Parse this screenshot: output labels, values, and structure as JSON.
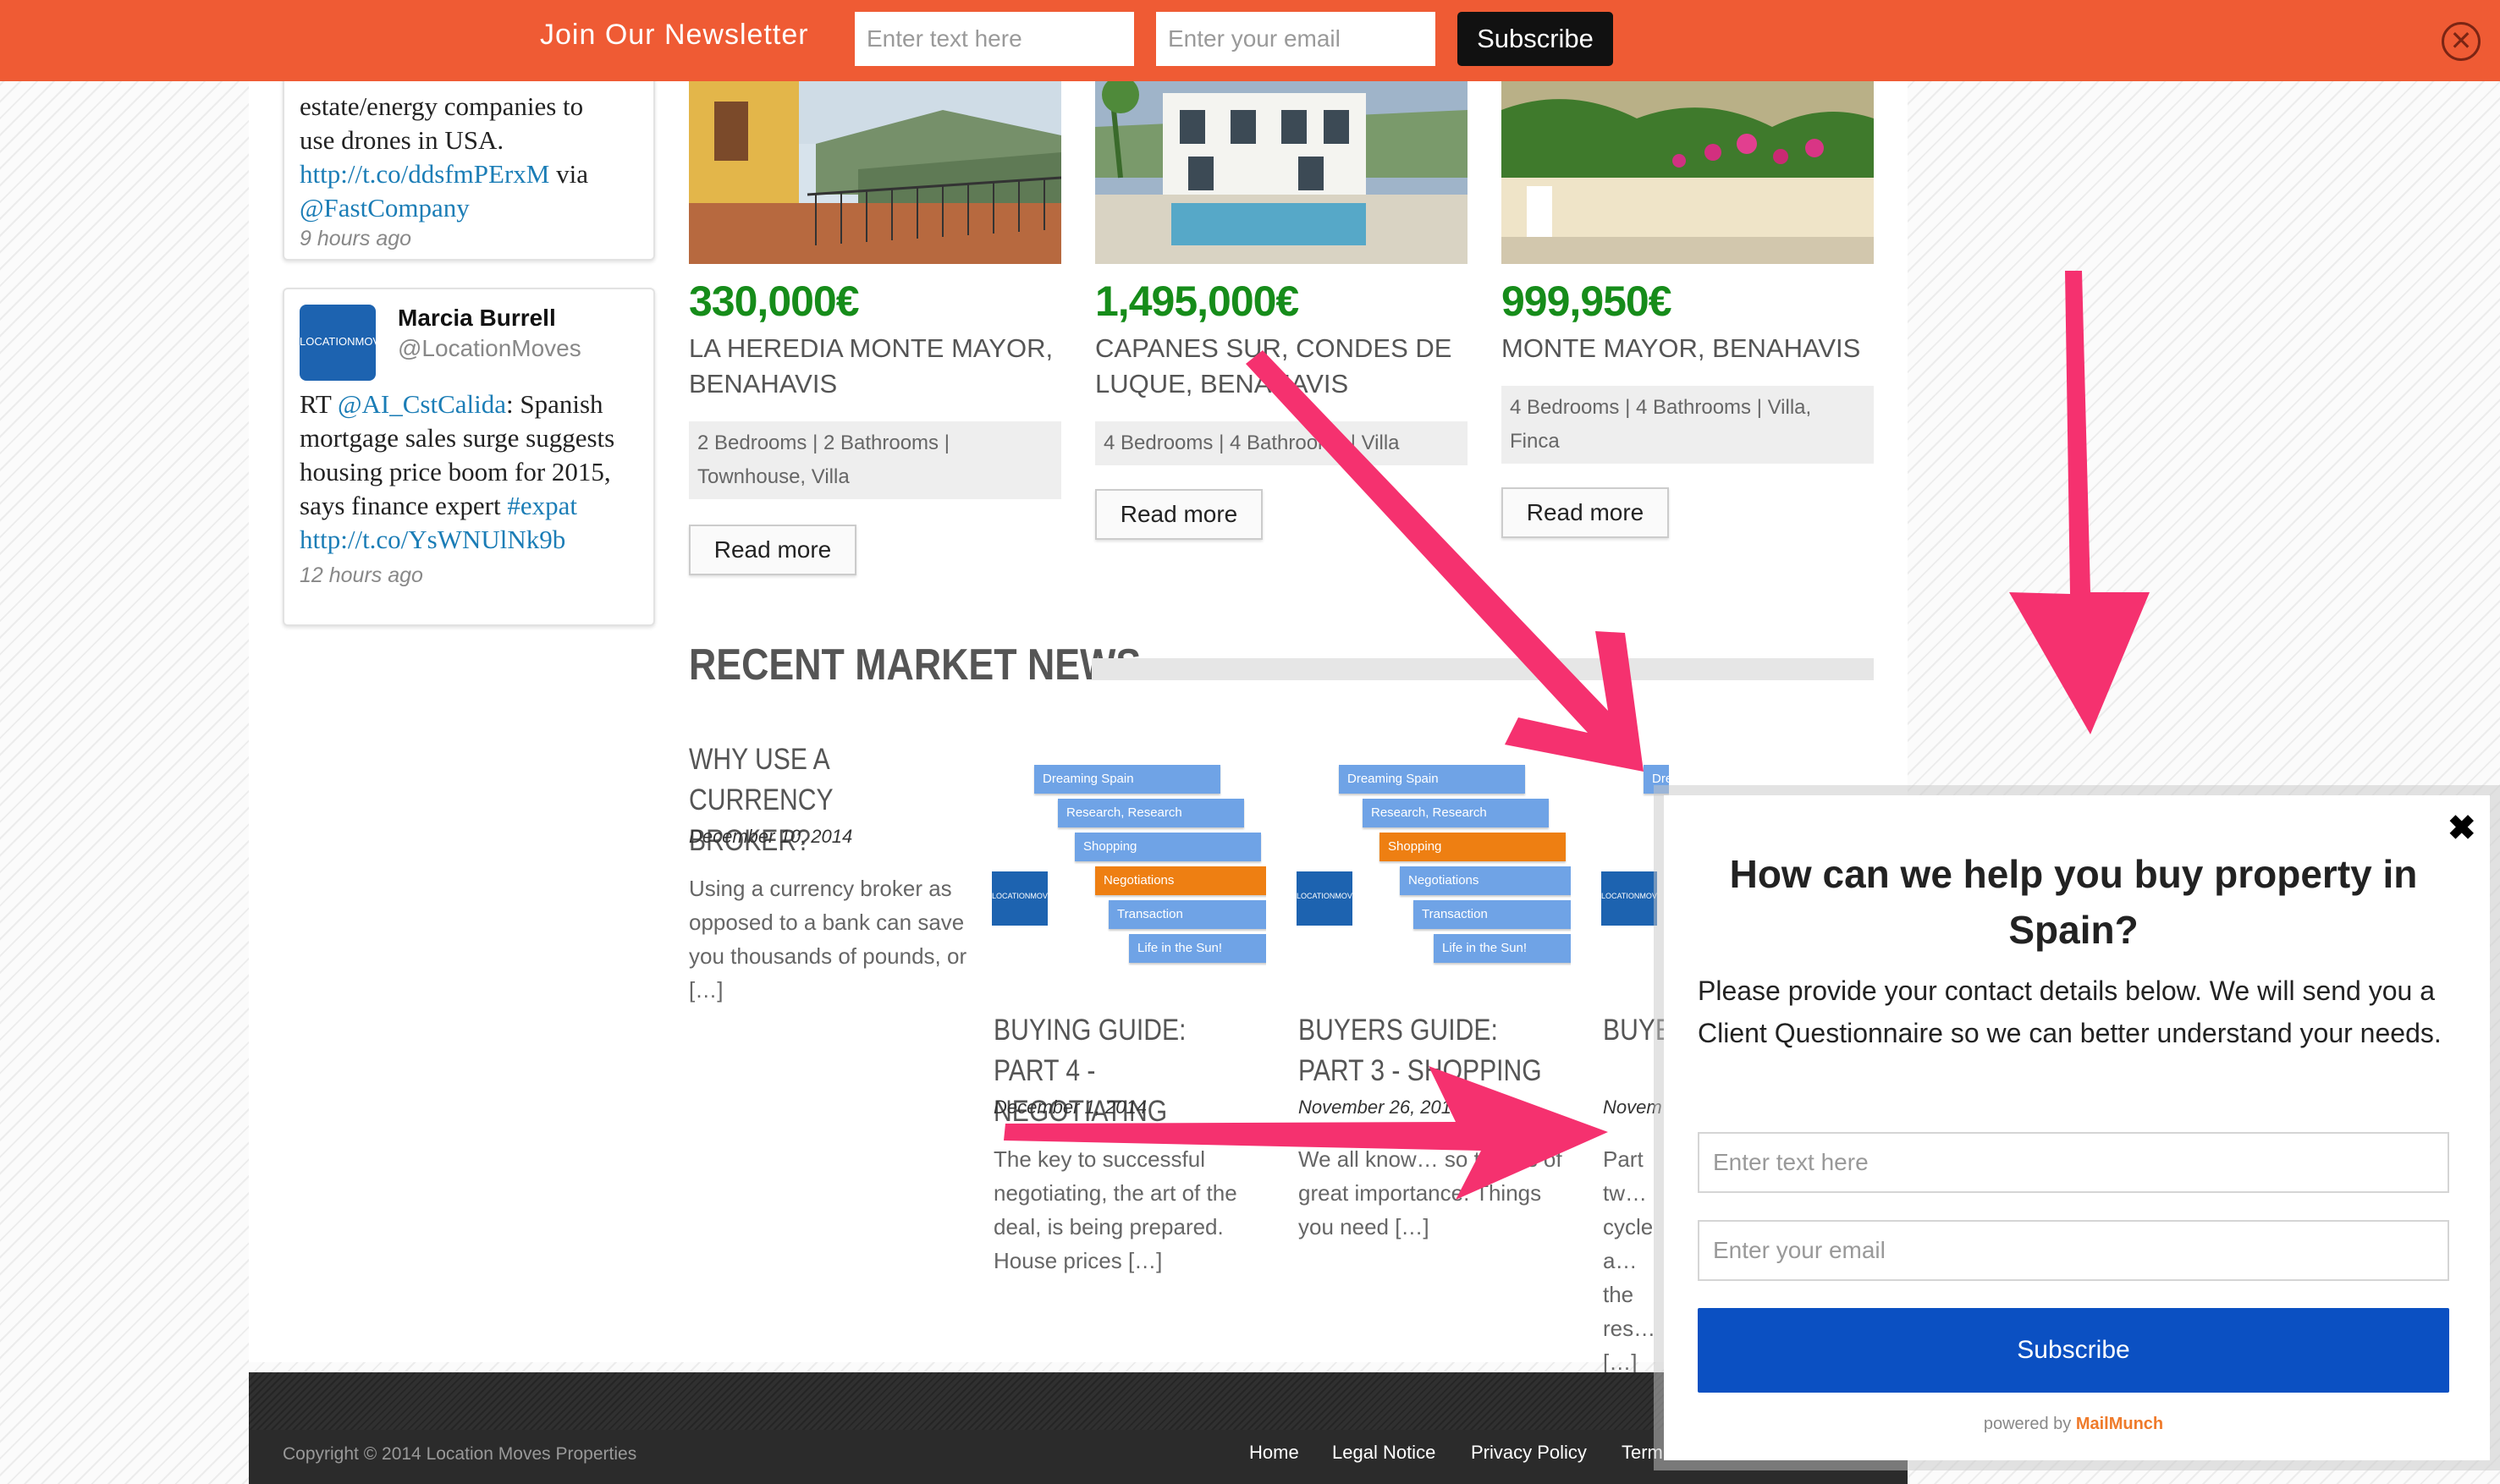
{
  "newsletter": {
    "title": "Join Our Newsletter",
    "name_placeholder": "Enter text here",
    "email_placeholder": "Enter your email",
    "subscribe_label": "Subscribe",
    "close_glyph": "✕"
  },
  "tweets": [
    {
      "text_lines": [
        "estate/energy companies to",
        "use drones in USA."
      ],
      "link": "http://t.co/ddsfmPErxM",
      "via": "via",
      "mention": "@FastCompany",
      "time": "9 hours ago"
    },
    {
      "name": "Marcia Burrell",
      "handle": "@LocationMoves",
      "rt": "RT",
      "mention": "@AI_CstCalida",
      "text": ": Spanish mortgage sales surge suggests housing price boom for 2015, says finance expert",
      "hashtag": "#expat",
      "link": "http://t.co/YsWNUlNk9b",
      "time": "12 hours ago"
    }
  ],
  "properties": [
    {
      "price": "330,000€",
      "name": "LA HEREDIA MONTE MAYOR, BENAHAVIS",
      "features": "2 Bedrooms | 2 Bathrooms | Townhouse, Villa",
      "button": "Read more"
    },
    {
      "price": "1,495,000€",
      "name": "CAPANES SUR, CONDES DE LUQUE, BENAHAVIS",
      "features": "4 Bedrooms | 4 Bathrooms | Villa",
      "button": "Read more"
    },
    {
      "price": "999,950€",
      "name": "MONTE MAYOR, BENAHAVIS",
      "features": "4 Bedrooms | 4 Bathrooms | Villa, Finca",
      "button": "Read more"
    }
  ],
  "news": {
    "section_title": "RECENT MARKET NEWS",
    "steps": [
      "Dreaming Spain",
      "Research, Research",
      "Shopping",
      "Negotiations",
      "Transaction",
      "Life in the Sun!"
    ],
    "logo_text": "LOCATIONMOVES",
    "articles": [
      {
        "title": "WHY USE A CURRENCY BROKER?",
        "date": "December 10, 2014",
        "excerpt": "Using a currency broker as opposed to a bank can save you thousands of pounds, or […]"
      },
      {
        "title": "BUYING GUIDE: PART 4 - NEGOTIATING",
        "date": "December 1, 2014",
        "excerpt": "The key to successful negotiating, the art of the deal, is being prepared. House prices […]"
      },
      {
        "title": "BUYERS GUIDE: PART 3 - SHOPPING",
        "date": "November 26, 2014",
        "excerpt": "We all know… so time is of great importance. Things you need […]"
      },
      {
        "title": "BUYE… - RES…",
        "date": "Novem…",
        "excerpt": "Part tw… cycle a… the res… […]"
      }
    ]
  },
  "footer": {
    "copyright": "Copyright © 2014 Location Moves Properties",
    "nav": [
      "Home",
      "Legal Notice",
      "Privacy Policy",
      "Term"
    ]
  },
  "popup": {
    "close_glyph": "✖",
    "title": "How can we help you buy property in Spain?",
    "body": "Please provide your contact details below. We will send you a Client Questionnaire so we can better understand your needs.",
    "name_placeholder": "Enter text here",
    "email_placeholder": "Enter your email",
    "subscribe_label": "Subscribe",
    "powered_by": "powered by",
    "brand": "MailMunch"
  },
  "colors": {
    "newsletter_bar": "#ef5b34",
    "price_green": "#168c1a",
    "popup_button": "#0b50c2",
    "annotation_arrow": "#f5316f",
    "step_blue": "#6fa3e6",
    "step_orange": "#ee7f12"
  }
}
